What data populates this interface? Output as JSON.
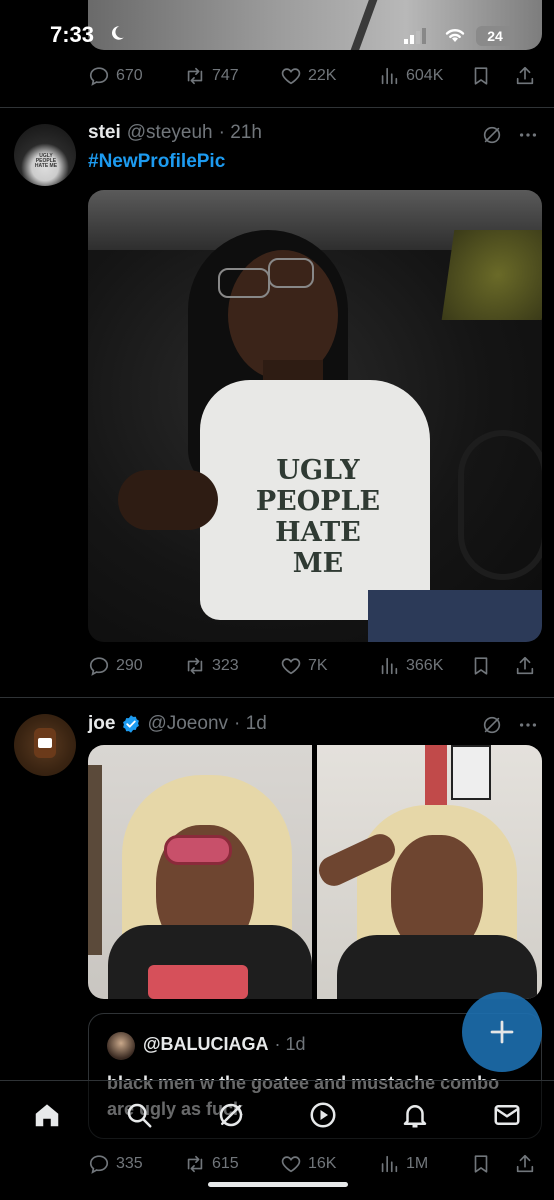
{
  "status_bar": {
    "time": "7:33",
    "battery": "24"
  },
  "post0": {
    "replies": "670",
    "reposts": "747",
    "likes": "22K",
    "views": "604K"
  },
  "post1": {
    "name": "stei",
    "handle": "@steyeuh",
    "time": "· 21h",
    "text": "#NewProfilePic",
    "shirt_text": [
      "UGLY",
      "PEOPLE",
      "HATE",
      "ME"
    ],
    "avatar_shirt_text": "UGLY PEOPLE HATE ME",
    "replies": "290",
    "reposts": "323",
    "likes": "7K",
    "views": "366K"
  },
  "post2": {
    "name": "joe",
    "handle": "@Joeonv",
    "time": "· 1d",
    "verified": true,
    "quote": {
      "handle": "@BALUCIAGA",
      "time": "· 1d",
      "text": "black men w the goatee and mustache combo are ugly as fuck"
    },
    "replies": "335",
    "reposts": "615",
    "likes": "16K",
    "views": "1M"
  },
  "icons": [
    "reply-icon",
    "repost-icon",
    "like-icon",
    "views-icon",
    "bookmark-icon",
    "share-icon",
    "grok-icon",
    "more-icon",
    "home-icon",
    "search-icon",
    "spaces-icon",
    "play-icon",
    "bell-icon",
    "mail-icon",
    "compose-icon"
  ],
  "colors": {
    "accent": "#1d9bf0",
    "muted": "#71767b",
    "text": "#e7e9ea",
    "bg": "#000000"
  }
}
